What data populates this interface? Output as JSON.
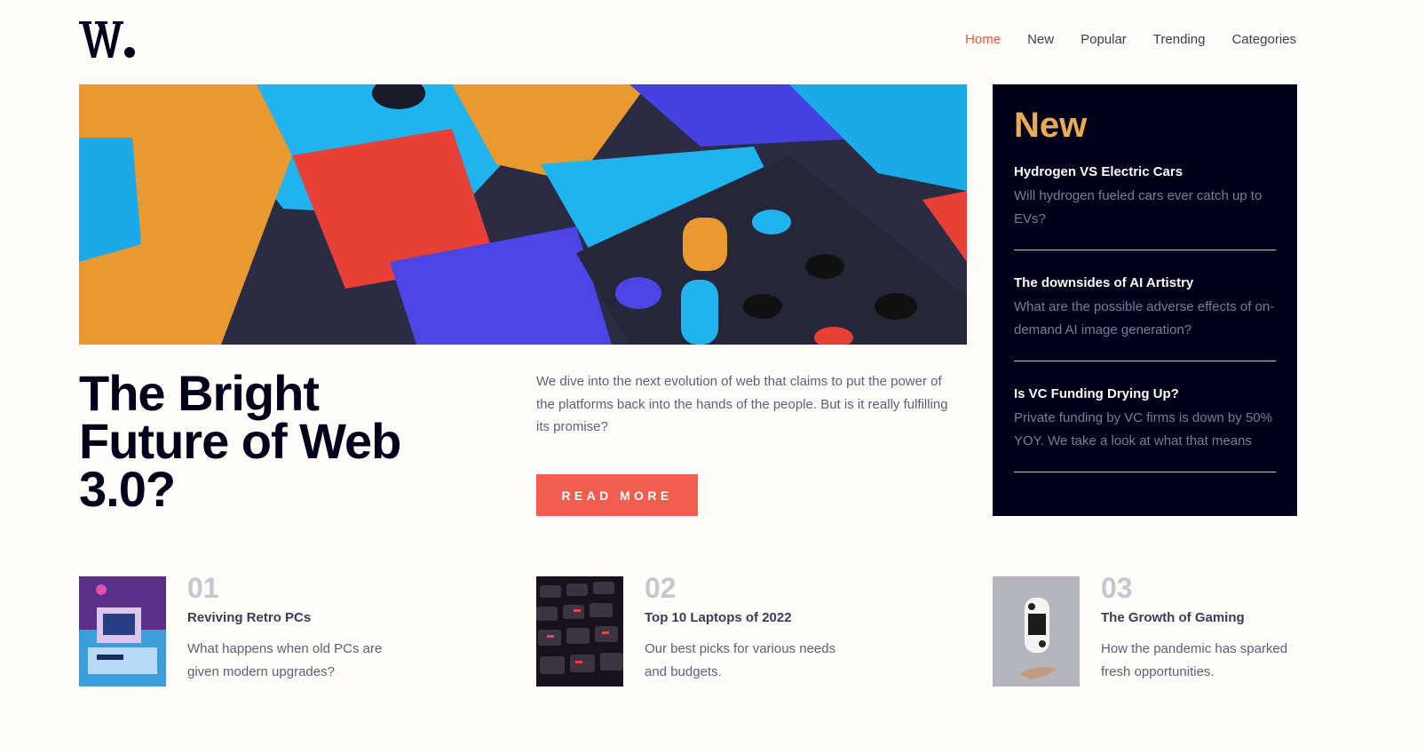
{
  "logo": {
    "text": "W."
  },
  "nav": {
    "items": [
      {
        "label": "Home",
        "active": true
      },
      {
        "label": "New",
        "active": false
      },
      {
        "label": "Popular",
        "active": false
      },
      {
        "label": "Trending",
        "active": false
      },
      {
        "label": "Categories",
        "active": false
      }
    ]
  },
  "hero": {
    "title": "The Bright Future of Web 3.0?",
    "description": "We dive into the next evolution of web that claims to put the power of the platforms back into the hands of the people. But is it really fulfilling its promise?",
    "button_label": "READ MORE"
  },
  "new_panel": {
    "heading": "New",
    "items": [
      {
        "title": "Hydrogen VS Electric Cars",
        "text": "Will hydrogen fueled cars ever catch up to EVs?"
      },
      {
        "title": "The downsides of AI Artistry",
        "text": "What are the possible adverse effects of on-demand AI image generation?"
      },
      {
        "title": "Is VC Funding Drying Up?",
        "text": "Private funding by VC firms is down by 50% YOY. We take a look at what that means"
      }
    ]
  },
  "cards": [
    {
      "number": "01",
      "title": "Reviving Retro PCs",
      "text": "What happens when old PCs are given modern upgrades?"
    },
    {
      "number": "02",
      "title": "Top 10 Laptops of 2022",
      "text": "Our best picks for various needs and budgets."
    },
    {
      "number": "03",
      "title": "The Growth of Gaming",
      "text": "How the pandemic has sparked fresh opportunities."
    }
  ],
  "colors": {
    "background": "#fffdf9",
    "accent_red": "#f15e50",
    "accent_orange": "#e9ab53",
    "dark_navy": "#00001a",
    "grayish_blue": "#5d5f79"
  }
}
